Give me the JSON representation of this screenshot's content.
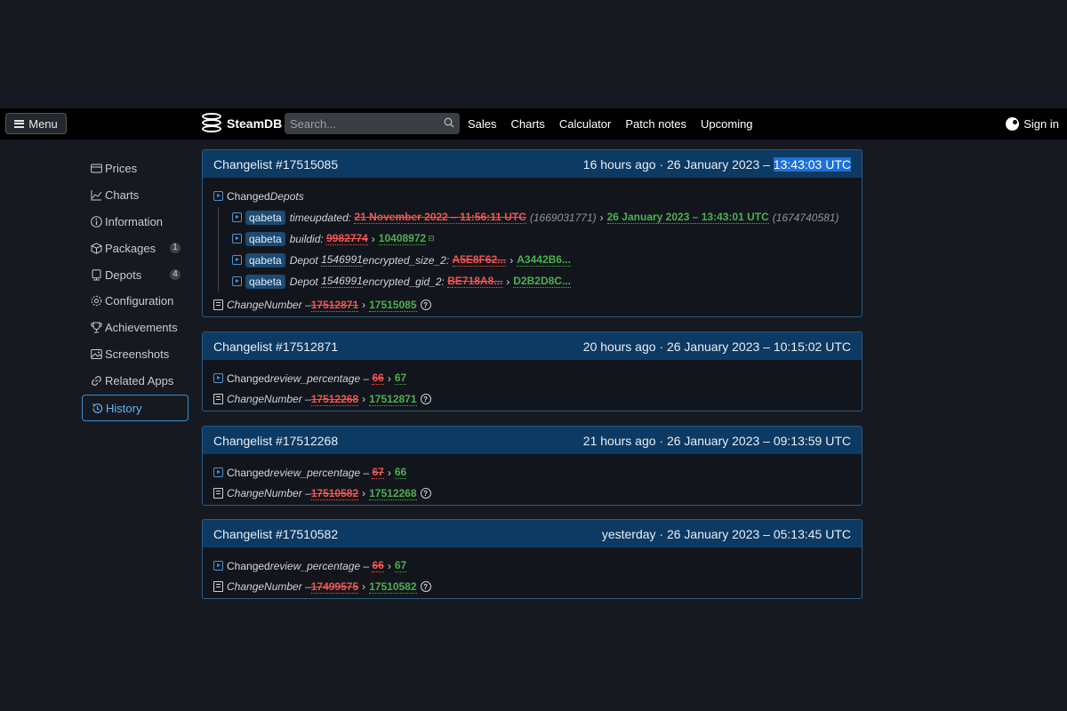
{
  "header": {
    "menu_label": "Menu",
    "logo_text": "SteamDB",
    "search_placeholder": "Search...",
    "nav": [
      "Sales",
      "Charts",
      "Calculator",
      "Patch notes",
      "Upcoming"
    ],
    "signin_label": "Sign in"
  },
  "sidebar": {
    "items": [
      {
        "label": "Prices",
        "icon": "card-icon"
      },
      {
        "label": "Charts",
        "icon": "chart-icon"
      },
      {
        "label": "Information",
        "icon": "info-icon"
      },
      {
        "label": "Packages",
        "icon": "package-icon",
        "count": "1"
      },
      {
        "label": "Depots",
        "icon": "depot-icon",
        "count": "4"
      },
      {
        "label": "Configuration",
        "icon": "gear-icon"
      },
      {
        "label": "Achievements",
        "icon": "trophy-icon"
      },
      {
        "label": "Screenshots",
        "icon": "image-icon"
      },
      {
        "label": "Related Apps",
        "icon": "link-icon"
      },
      {
        "label": "History",
        "icon": "history-icon",
        "active": true
      }
    ]
  },
  "changelists": [
    {
      "title": "Changelist #17515085",
      "time_prefix": "16 hours ago · 26 January 2023 – ",
      "time_highlight": "13:43:03 UTC",
      "changed_prefix": "Changed ",
      "changed_field": "Depots",
      "depot_rows": [
        {
          "tag": "qabeta",
          "field": "timeupdated:",
          "old": "21 November 2022 – 11:56:11 UTC",
          "old_extra": "(1669031771)",
          "new": "26 January 2023 – 13:43:01 UTC",
          "new_extra": "(1674740581)"
        },
        {
          "tag": "qabeta",
          "field": "buildid:",
          "old": "9982774",
          "new": "10408972"
        },
        {
          "tag": "qabeta",
          "field_prefix": "Depot ",
          "depot_id": "1546991",
          "field": " encrypted_size_2:",
          "old": "A5E8F62...",
          "new": "A3442B6..."
        },
        {
          "tag": "qabeta",
          "field_prefix": "Depot ",
          "depot_id": "1546991",
          "field": " encrypted_gid_2:",
          "old": "BE718A8...",
          "new": "D2B2D8C..."
        }
      ],
      "changenumber": {
        "label": "ChangeNumber – ",
        "old": "17512871",
        "new": "17515085"
      }
    },
    {
      "title": "Changelist #17512871",
      "time_prefix": "20 hours ago · 26 January 2023 – 10:15:02 UTC",
      "changed_prefix": "Changed ",
      "changed_field": "review_percentage",
      "review": {
        "old": "66",
        "new": "67"
      },
      "changenumber": {
        "label": "ChangeNumber – ",
        "old": "17512268",
        "new": "17512871"
      }
    },
    {
      "title": "Changelist #17512268",
      "time_prefix": "21 hours ago · 26 January 2023 – 09:13:59 UTC",
      "changed_prefix": "Changed ",
      "changed_field": "review_percentage",
      "review": {
        "old": "67",
        "new": "66"
      },
      "changenumber": {
        "label": "ChangeNumber – ",
        "old": "17510582",
        "new": "17512268"
      }
    },
    {
      "title": "Changelist #17510582",
      "time_prefix": "yesterday · 26 January 2023 – 05:13:45 UTC",
      "changed_prefix": "Changed ",
      "changed_field": "review_percentage",
      "review": {
        "old": "66",
        "new": "67"
      },
      "changenumber": {
        "label": "ChangeNumber – ",
        "old": "17499575",
        "new": "17510582"
      }
    }
  ],
  "colors": {
    "accent": "#64b5f6",
    "old_value": "#ef5350",
    "new_value": "#4caf50",
    "card_header": "#0d3a63"
  }
}
